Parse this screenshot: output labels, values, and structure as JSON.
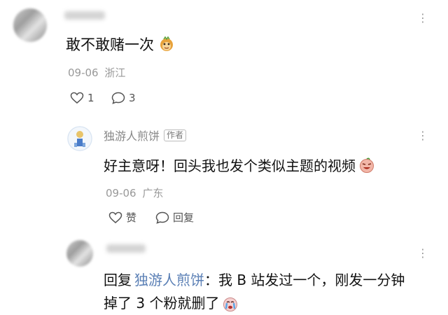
{
  "comment1": {
    "text": "敢不敢赌一次",
    "emoji": "monkey-emoji",
    "date": "09-06",
    "location": "浙江",
    "like_count": "1",
    "reply_count": "3"
  },
  "comment2": {
    "username": "独游人煎饼",
    "badge": "作者",
    "text": "好主意呀！回头我也发个类似主题的视频",
    "emoji": "peach-face-emoji",
    "date": "09-06",
    "location": "广东",
    "like_label": "赞",
    "reply_label": "回复"
  },
  "comment3": {
    "reply_prefix": "回复",
    "reply_to": "独游人煎饼",
    "line1_rest": "：我 B 站发过一个，刚发一分钟",
    "line2": "掉了 3 个粉就删了",
    "emoji": "crying-face-emoji"
  },
  "colors": {
    "meta_gray": "#999999",
    "reply_link_blue": "#5a7fb5"
  }
}
